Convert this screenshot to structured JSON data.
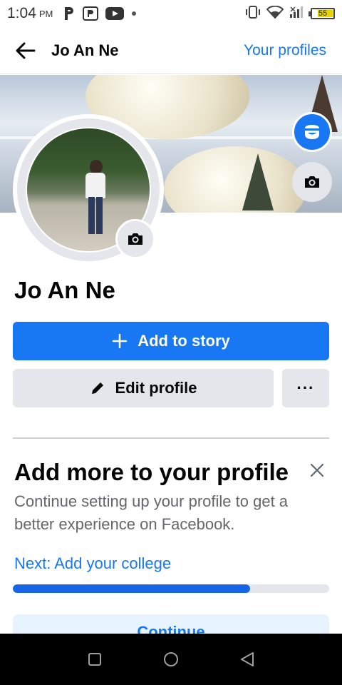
{
  "status_bar": {
    "time": "1:04",
    "ampm": "PM",
    "battery_level": "55"
  },
  "header": {
    "title": "Jo An Ne",
    "right_link": "Your profiles"
  },
  "profile": {
    "name": "Jo An Ne"
  },
  "actions": {
    "add_to_story": "Add to story",
    "edit_profile": "Edit profile",
    "more": "···"
  },
  "card": {
    "title": "Add more to your profile",
    "description": "Continue setting up your profile to get a better experience on Facebook.",
    "next_step": "Next: Add your college",
    "progress": 0.75,
    "continue_label": "Continue"
  },
  "colors": {
    "primary": "#1877f2",
    "secondary_bg": "#e4e6eb",
    "text_secondary": "#65676b"
  },
  "icons": {
    "status_left": [
      "p-app-icon",
      "parking-icon",
      "youtube-icon",
      "dot-icon"
    ],
    "status_right": [
      "vibrate-icon",
      "wifi-icon",
      "signal-icon",
      "battery-icon"
    ],
    "nav": [
      "recents-icon",
      "home-icon",
      "back-triangle-icon"
    ]
  }
}
